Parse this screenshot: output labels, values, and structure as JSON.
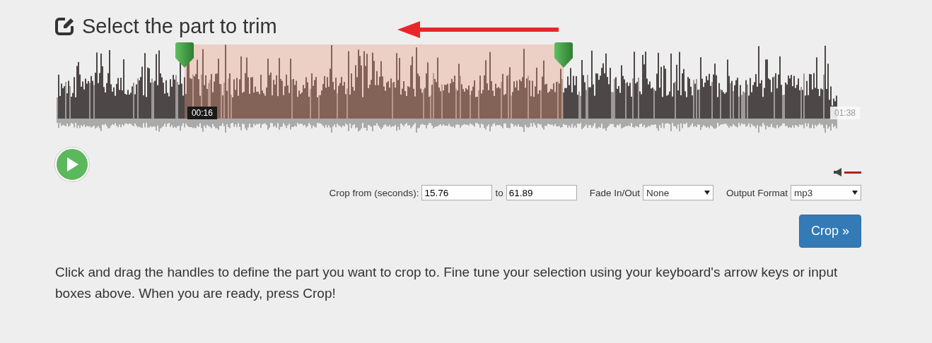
{
  "heading": {
    "title": "Select the part to trim"
  },
  "waveform": {
    "handles": [
      {
        "level": 0.163
      },
      {
        "level": 0.646
      }
    ],
    "start_time": "00:16",
    "end_time": "01:38"
  },
  "volume": {
    "level": 1
  },
  "controls": {
    "crop_from_label": "Crop from (seconds):",
    "from_value": "15.76",
    "to_label": "to",
    "to_value": "61.89",
    "fade_label": "Fade In/Out",
    "fade_value": "None",
    "format_label": "Output Format",
    "format_value": "mp3"
  },
  "crop_button": "Crop »",
  "instructions": "Click and drag the handles to define the part you want to crop to. Fine tune your selection using your keyboard's arrow keys or input boxes above. When you are ready, press Crop!"
}
